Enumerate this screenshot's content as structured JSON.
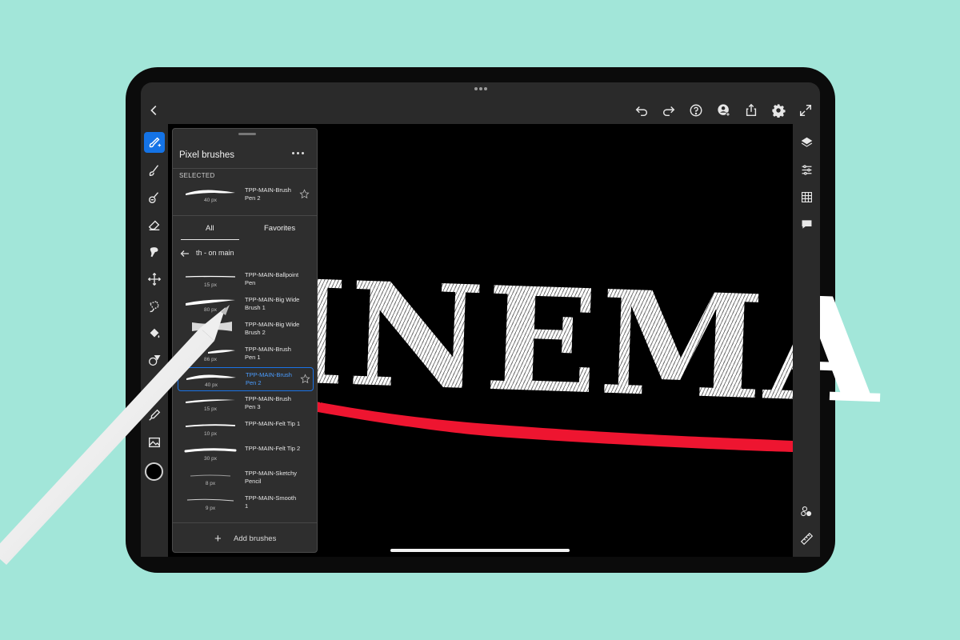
{
  "topbar": {
    "icons": [
      "back-icon",
      "undo-icon",
      "redo-icon",
      "help-icon",
      "user-share-icon",
      "export-icon",
      "settings-icon",
      "fullscreen-icon"
    ]
  },
  "canvas": {
    "art_text": "INEMA",
    "stroke_color": "#ee1530"
  },
  "left_tools": [
    "brush-tool-icon",
    "smudge-icon",
    "mixer-brush-icon",
    "eraser-icon",
    "liquify-icon",
    "transform-icon",
    "lasso-icon",
    "fill-icon",
    "shape-icon",
    "eyedropper-icon",
    "image-icon"
  ],
  "right_tools": [
    "layers-icon",
    "adjustments-icon",
    "grid-icon",
    "comment-icon",
    "share-icon",
    "ruler-icon"
  ],
  "accent_color": "#1473e6",
  "panel": {
    "title": "Pixel brushes",
    "selected_label": "SELECTED",
    "selected": {
      "name": "TPP-MAIN-Brush Pen 2",
      "size": "40 px"
    },
    "tabs": [
      "All",
      "Favorites"
    ],
    "folder": "th - on main",
    "brushes": [
      {
        "name": "TPP-MAIN-Ballpoint Pen",
        "size": "15 px"
      },
      {
        "name": "TPP-MAIN-Big Wide Brush 1",
        "size": "80 px"
      },
      {
        "name": "TPP-MAIN-Big Wide Brush 2",
        "size": ""
      },
      {
        "name": "TPP-MAIN-Brush Pen 1",
        "size": "86 px"
      },
      {
        "name": "TPP-MAIN-Brush Pen 2",
        "size": "40 px"
      },
      {
        "name": "TPP-MAIN-Brush Pen 3",
        "size": "15 px"
      },
      {
        "name": "TPP-MAIN-Felt Tip 1",
        "size": "10 px"
      },
      {
        "name": "TPP-MAIN-Felt Tip 2",
        "size": "30 px"
      },
      {
        "name": "TPP-MAIN-Sketchy Pencil",
        "size": "8 px"
      },
      {
        "name": "TPP-MAIN-Smooth 1",
        "size": "9 px"
      }
    ],
    "add_label": "Add brushes"
  }
}
